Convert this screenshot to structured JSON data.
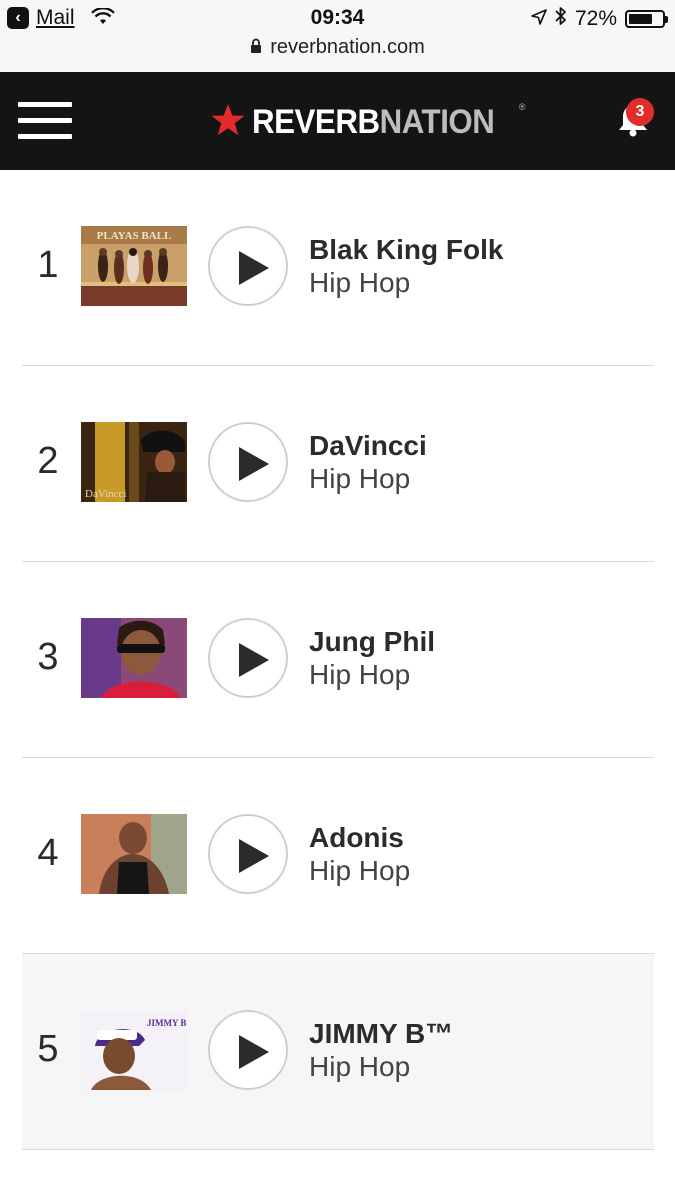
{
  "status_bar": {
    "back_app": "Mail",
    "time": "09:34",
    "battery_pct": "72%",
    "battery_level": 0.72,
    "url": "reverbnation.com",
    "icons": [
      "back-arrow-icon",
      "wifi-icon",
      "location-arrow-icon",
      "bluetooth-icon",
      "battery-icon",
      "lock-icon"
    ]
  },
  "header": {
    "logo_part1": "REVERB",
    "logo_part2": "NATION",
    "logo_reg": "®",
    "notification_count": "3",
    "icons": [
      "hamburger-menu-icon",
      "star-logo-icon",
      "bell-icon"
    ],
    "colors": {
      "bar": "#141414",
      "star": "#e22b2b",
      "badge": "#e22b2b"
    }
  },
  "chart_list": {
    "items": [
      {
        "rank": "1",
        "artist": "Blak King Folk",
        "genre": "Hip Hop"
      },
      {
        "rank": "2",
        "artist": "DaVincci",
        "genre": "Hip Hop"
      },
      {
        "rank": "3",
        "artist": "Jung Phil",
        "genre": "Hip Hop"
      },
      {
        "rank": "4",
        "artist": "Adonis",
        "genre": "Hip Hop"
      },
      {
        "rank": "5",
        "artist": "JIMMY B™",
        "genre": "Hip Hop"
      }
    ],
    "thumb_text": {
      "item1": "PLAYAS BALL",
      "item2": "DaVincci",
      "item5": "JIMMY B"
    }
  }
}
